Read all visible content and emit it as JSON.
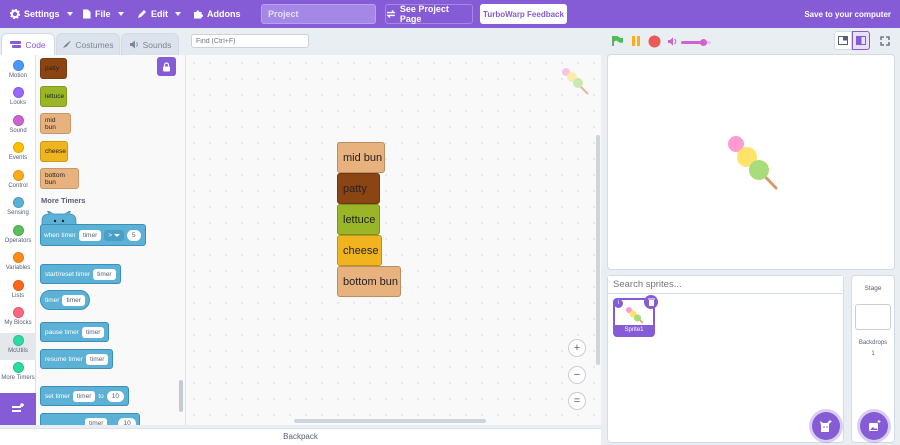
{
  "menubar": {
    "settings": "Settings",
    "file": "File",
    "edit": "Edit",
    "addons": "Addons",
    "project_title": "Project",
    "see_project_page": "See Project Page",
    "feedback": "TurboWarp Feedback",
    "save": "Save to your computer",
    "accent": "#855cd6"
  },
  "tabs": {
    "code": "Code",
    "costumes": "Costumes",
    "sounds": "Sounds"
  },
  "find": {
    "placeholder": "Find (Ctrl+F)"
  },
  "categories": [
    {
      "label": "Motion",
      "color": "#4c97ff"
    },
    {
      "label": "Looks",
      "color": "#9966ff"
    },
    {
      "label": "Sound",
      "color": "#cf63cf"
    },
    {
      "label": "Events",
      "color": "#ffbf00"
    },
    {
      "label": "Control",
      "color": "#ffab19"
    },
    {
      "label": "Sensing",
      "color": "#5cb1d6"
    },
    {
      "label": "Operators",
      "color": "#59c059"
    },
    {
      "label": "Variables",
      "color": "#ff8c1a"
    },
    {
      "label": "Lists",
      "color": "#ff661a"
    },
    {
      "label": "My Blocks",
      "color": "#ff6680"
    },
    {
      "label": "McUtils",
      "color": "#2edba0"
    },
    {
      "label": "More Timers",
      "color": "#2edba0"
    }
  ],
  "palette": {
    "food_blocks": [
      {
        "label": "patty",
        "color": "#8b4513"
      },
      {
        "label": "lettuce",
        "color": "#9ab526"
      },
      {
        "label": "mid bun",
        "color": "#e8b27e"
      },
      {
        "label": "cheese",
        "color": "#f0b41e"
      },
      {
        "label": "bottom bun",
        "color": "#e8b27e"
      }
    ],
    "section_title": "More Timers",
    "when_timer": {
      "label": "when timer",
      "field": "timer",
      "op": ">",
      "value": "5"
    },
    "start_reset": {
      "label": "start/reset timer",
      "field": "timer"
    },
    "timer_reporter": {
      "label": "timer",
      "field": "timer"
    },
    "pause": {
      "label": "pause timer",
      "field": "timer"
    },
    "resume": {
      "label": "resume timer",
      "field": "timer"
    },
    "set_timer": {
      "label": "set timer",
      "field": "timer",
      "to": "to",
      "value": "10"
    },
    "cut_block": {
      "field": "timer",
      "value": "10"
    }
  },
  "workspace": {
    "stack": [
      {
        "label": "mid bun",
        "color": "#e8b27e"
      },
      {
        "label": "patty",
        "color": "#8b4513"
      },
      {
        "label": "lettuce",
        "color": "#9ab526"
      },
      {
        "label": "cheese",
        "color": "#f0b41e"
      },
      {
        "label": "bottom bun",
        "color": "#e8b27e"
      }
    ],
    "zoom_in": "+",
    "zoom_out": "−",
    "zoom_reset": "="
  },
  "backpack": "Backpack",
  "sprites": {
    "search_placeholder": "Search sprites...",
    "selected": "Sprite1"
  },
  "stage_pane": {
    "title": "Stage",
    "backdrops_label": "Backdrops",
    "backdrops_count": "1"
  },
  "sound_volume": 0.75
}
